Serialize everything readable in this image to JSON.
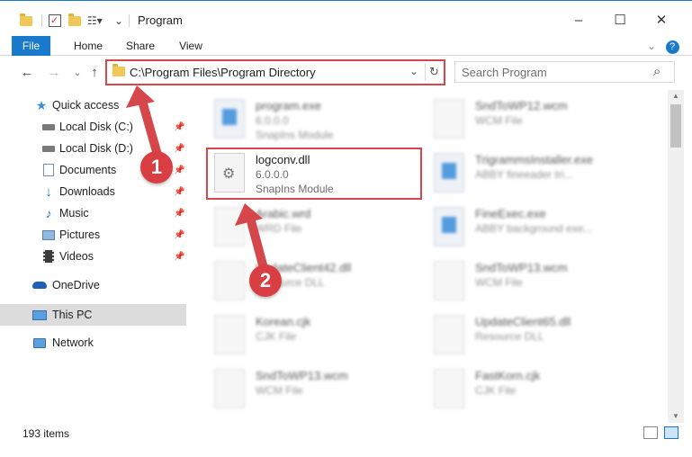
{
  "window": {
    "title": "Program",
    "minimize": "–",
    "maximize": "☐",
    "close": "✕"
  },
  "ribbon": {
    "tabs": [
      "File",
      "Home",
      "Share",
      "View"
    ],
    "collapse": "⌄",
    "help": "?"
  },
  "nav": {
    "back": "←",
    "forward": "→",
    "recent": "⌄",
    "up": "↑",
    "address": "C:\\Program Files\\Program Directory",
    "address_dropdown": "⌄",
    "refresh": "↻",
    "search_placeholder": "Search Program",
    "search_icon": "⌕"
  },
  "sidebar": {
    "items": [
      {
        "label": "Quick access",
        "icon": "star-icon",
        "pinned": false
      },
      {
        "label": "Local Disk (C:)",
        "icon": "drive-icon",
        "pinned": true
      },
      {
        "label": "Local Disk (D:)",
        "icon": "drive-icon",
        "pinned": true
      },
      {
        "label": "Documents",
        "icon": "documents-icon",
        "pinned": true
      },
      {
        "label": "Downloads",
        "icon": "downloads-icon",
        "pinned": true
      },
      {
        "label": "Music",
        "icon": "music-icon",
        "pinned": true
      },
      {
        "label": "Pictures",
        "icon": "pictures-icon",
        "pinned": true
      },
      {
        "label": "Videos",
        "icon": "videos-icon",
        "pinned": true
      },
      {
        "label": "OneDrive",
        "icon": "cloud-icon",
        "pinned": false
      },
      {
        "label": "This PC",
        "icon": "computer-icon",
        "pinned": false,
        "selected": true
      },
      {
        "label": "Network",
        "icon": "network-icon",
        "pinned": false
      }
    ]
  },
  "files": [
    {
      "name": "program.exe",
      "line1": "6.0.0.0",
      "line2": "SnapIns Module",
      "type": "exe-icon",
      "blurred": true
    },
    {
      "name": "SndToWP12.wcm",
      "line1": "WCM File",
      "line2": "",
      "type": "file-icon",
      "blurred": true
    },
    {
      "name": "logconv.dll",
      "line1": "6.0.0.0",
      "line2": "SnapIns Module",
      "type": "dll-icon",
      "blurred": false
    },
    {
      "name": "TrigrammsInstaller.exe",
      "line1": "ABBY fineeader tri...",
      "line2": "",
      "type": "exe-icon",
      "blurred": true
    },
    {
      "name": "Arabic.wrd",
      "line1": "WRD File",
      "line2": "",
      "type": "file-icon",
      "blurred": true
    },
    {
      "name": "FineExec.exe",
      "line1": "ABBY background exe...",
      "line2": "",
      "type": "exe-icon",
      "blurred": true
    },
    {
      "name": "UpdateClient42.dll",
      "line1": "Resource DLL",
      "line2": "",
      "type": "dll-icon",
      "blurred": true
    },
    {
      "name": "SndToWP13.wcm",
      "line1": "WCM File",
      "line2": "",
      "type": "file-icon",
      "blurred": true
    },
    {
      "name": "Korean.cjk",
      "line1": "CJK File",
      "line2": "",
      "type": "file-icon",
      "blurred": true
    },
    {
      "name": "UpdateClient65.dll",
      "line1": "Resource DLL",
      "line2": "",
      "type": "dll-icon",
      "blurred": true
    },
    {
      "name": "SndToWP13.wcm",
      "line1": "WCM File",
      "line2": "",
      "type": "file-icon",
      "blurred": true
    },
    {
      "name": "FastKorn.cjk",
      "line1": "CJK File",
      "line2": "",
      "type": "file-icon",
      "blurred": true
    }
  ],
  "status": {
    "count": "193 items"
  },
  "annotations": {
    "step1": "1",
    "step2": "2",
    "color": "#d6474b"
  }
}
